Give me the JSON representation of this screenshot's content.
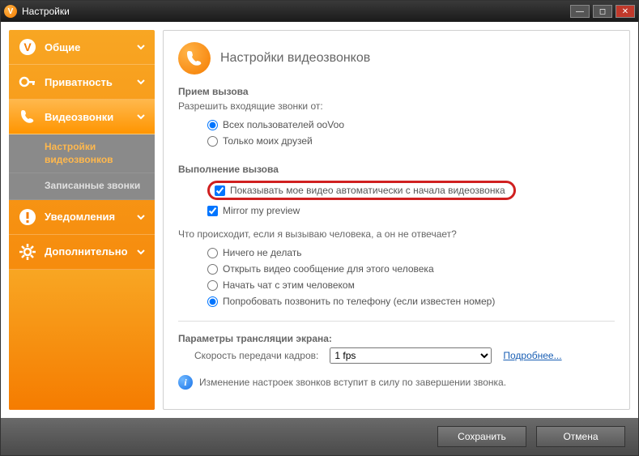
{
  "window": {
    "title": "Настройки"
  },
  "sidebar": {
    "items": [
      {
        "label": "Общие"
      },
      {
        "label": "Приватность"
      },
      {
        "label": "Видеозвонки"
      },
      {
        "label": "Уведомления"
      },
      {
        "label": "Дополнительно"
      }
    ],
    "sub": [
      {
        "label": "Настройки видеозвонков"
      },
      {
        "label": "Записанные звонки"
      }
    ]
  },
  "header": {
    "title": "Настройки видеозвонков"
  },
  "incoming": {
    "title": "Прием вызова",
    "sub": "Разрешить входящие звонки от:",
    "opt_all": "Всех пользователей ooVoo",
    "opt_friends": "Только моих друзей"
  },
  "outgoing": {
    "title": "Выполнение вызова",
    "chk_show_video": "Показывать мое видео автоматически с начала видеозвонка",
    "chk_mirror": "Mirror my preview",
    "no_answer_q": "Что происходит, если я вызываю человека, а он не отвечает?",
    "opt_nothing": "Ничего не делать",
    "opt_vmsg": "Открыть видео сообщение для этого человека",
    "opt_chat": "Начать чат с этим человеком",
    "opt_phone": "Попробовать позвонить по телефону (если известен номер)"
  },
  "screen": {
    "title": "Параметры трансляции экрана:",
    "fps_label": "Скорость передачи кадров:",
    "fps_value": "1 fps",
    "more": "Подробнее..."
  },
  "info": {
    "text": "Изменение настроек звонков вступит в силу по завершении звонка."
  },
  "footer": {
    "save": "Сохранить",
    "cancel": "Отмена"
  }
}
